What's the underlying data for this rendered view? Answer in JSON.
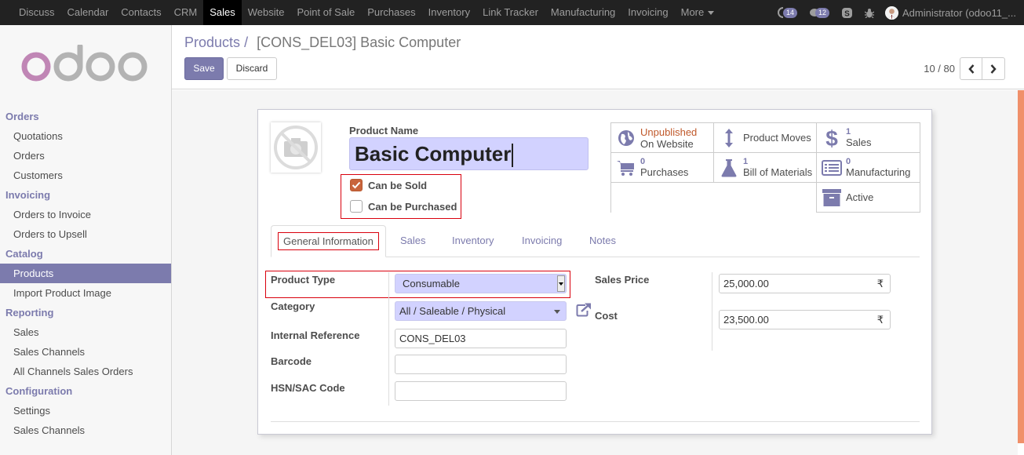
{
  "topbar": {
    "apps": [
      "Discuss",
      "Calendar",
      "Contacts",
      "CRM",
      "Sales",
      "Website",
      "Point of Sale",
      "Purchases",
      "Inventory",
      "Link Tracker",
      "Manufacturing",
      "Invoicing",
      "More"
    ],
    "active_app": "Sales",
    "more_icon": "caret-down-icon",
    "systray": {
      "activity_count": "14",
      "messages_count": "12",
      "skype_icon": "skype-icon",
      "debug_icon": "bug-icon"
    },
    "user": "Administrator (odoo11_..."
  },
  "sidebar": {
    "sections": [
      {
        "title": "Orders",
        "items": [
          "Quotations",
          "Orders",
          "Customers"
        ]
      },
      {
        "title": "Invoicing",
        "items": [
          "Orders to Invoice",
          "Orders to Upsell"
        ]
      },
      {
        "title": "Catalog",
        "items": [
          "Products",
          "Import Product Image"
        ]
      },
      {
        "title": "Reporting",
        "items": [
          "Sales",
          "Sales Channels",
          "All Channels Sales Orders"
        ]
      },
      {
        "title": "Configuration",
        "items": [
          "Settings",
          "Sales Channels"
        ]
      }
    ],
    "active_item": "Products"
  },
  "control_panel": {
    "breadcrumb_parent": "Products",
    "breadcrumb_sep": "/",
    "breadcrumb_current": "[CONS_DEL03] Basic Computer",
    "save_label": "Save",
    "discard_label": "Discard",
    "pager_value": "10 / 80"
  },
  "form": {
    "product_name_label": "Product Name",
    "product_name": "Basic Computer",
    "can_be_sold_label": "Can be Sold",
    "can_be_sold": true,
    "can_be_purchased_label": "Can be Purchased",
    "can_be_purchased": false,
    "smart_buttons": [
      {
        "icon": "globe-icon",
        "top": "Unpublished",
        "bottom": "On Website",
        "style": "warn"
      },
      {
        "icon": "arrows-v-icon",
        "top": "",
        "bottom": "Product Moves"
      },
      {
        "icon": "dollar-icon",
        "top": "1",
        "bottom": "Sales"
      },
      {
        "icon": "cart-icon",
        "top": "0",
        "bottom": "Purchases"
      },
      {
        "icon": "flask-icon",
        "top": "1",
        "bottom": "Bill of Materials"
      },
      {
        "icon": "list-alt-icon",
        "top": "0",
        "bottom": "Manufacturing"
      },
      {
        "icon": "archive-icon",
        "top": "",
        "bottom": "Active"
      }
    ],
    "tabs": [
      "General Information",
      "Sales",
      "Inventory",
      "Invoicing",
      "Notes"
    ],
    "active_tab": "General Information",
    "fields": {
      "product_type_label": "Product Type",
      "product_type": "Consumable",
      "category_label": "Category",
      "category": "All / Saleable / Physical",
      "internal_ref_label": "Internal Reference",
      "internal_ref": "CONS_DEL03",
      "barcode_label": "Barcode",
      "barcode": "",
      "hsn_label": "HSN/SAC Code",
      "hsn": "",
      "sales_price_label": "Sales Price",
      "sales_price": "25,000.00",
      "cost_label": "Cost",
      "cost": "23,500.00",
      "currency_symbol": "₹"
    }
  },
  "colors": {
    "brand": "#7c7bad",
    "topbar": "#222222",
    "required_field": "#d2d2ff",
    "highlight_box": "#d9000d",
    "scrollbar": "#f0906a",
    "warn_text": "#c0592b",
    "checkbox_on": "#c8643c"
  }
}
